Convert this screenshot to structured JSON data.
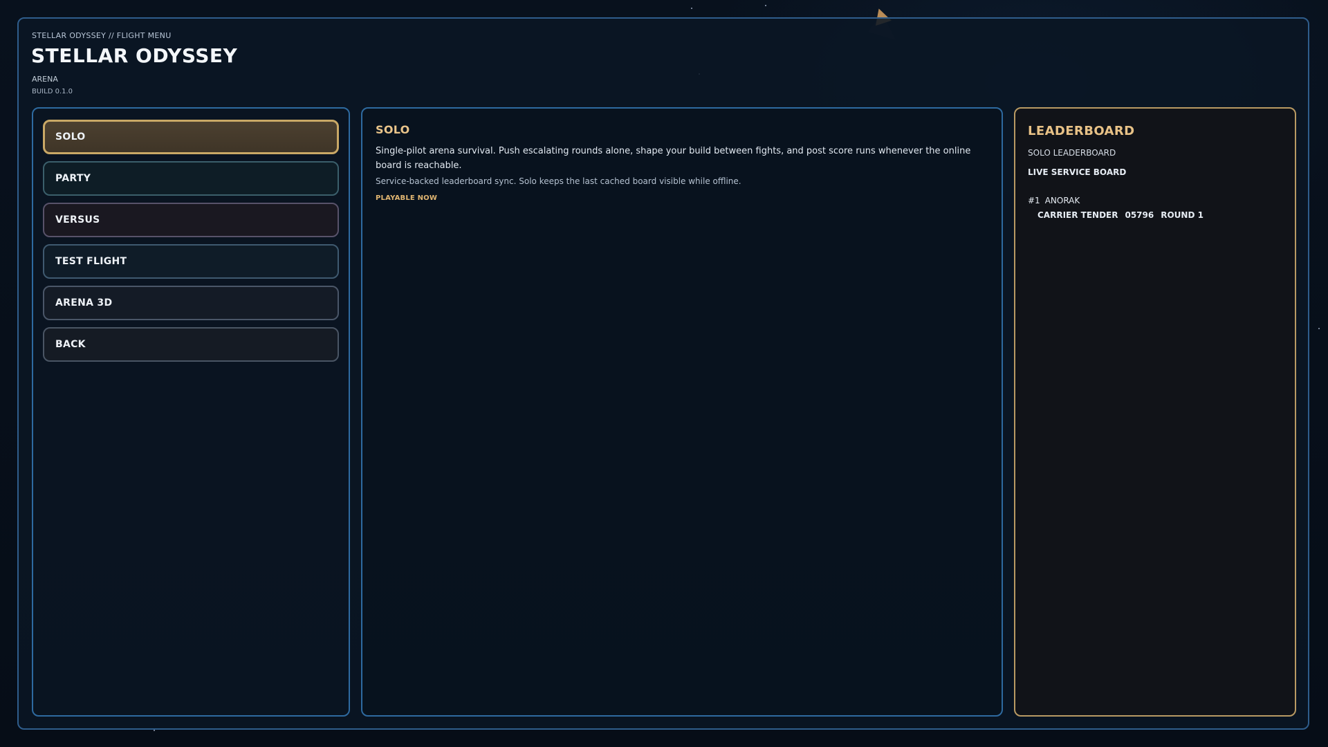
{
  "header": {
    "breadcrumb": "STELLAR ODYSSEY // FLIGHT MENU",
    "title": "STELLAR ODYSSEY",
    "mode": "ARENA",
    "build": "BUILD 0.1.0"
  },
  "menu": {
    "items": [
      {
        "label": "SOLO",
        "selected": true
      },
      {
        "label": "PARTY",
        "selected": false
      },
      {
        "label": "VERSUS",
        "selected": false
      },
      {
        "label": "TEST FLIGHT",
        "selected": false
      },
      {
        "label": "ARENA 3D",
        "selected": false
      },
      {
        "label": "BACK",
        "selected": false
      }
    ]
  },
  "detail": {
    "title": "SOLO",
    "description": "Single-pilot arena survival. Push escalating rounds alone, shape your build between fights, and post score runs whenever the online board is reachable.",
    "note": "Service-backed leaderboard sync. Solo keeps the last cached board visible while offline.",
    "status": "PLAYABLE NOW"
  },
  "leaderboard": {
    "title": "LEADERBOARD",
    "subtitle": "SOLO LEADERBOARD",
    "service": "LIVE SERVICE BOARD",
    "entries": [
      {
        "rank": "#1",
        "name": "ANORAK",
        "ship": "CARRIER TENDER",
        "score": "05796",
        "round": "ROUND 1"
      }
    ]
  },
  "colors": {
    "accent_gold": "#c9a866",
    "panel_blue": "#2e6aa0",
    "background": "#050a11"
  }
}
